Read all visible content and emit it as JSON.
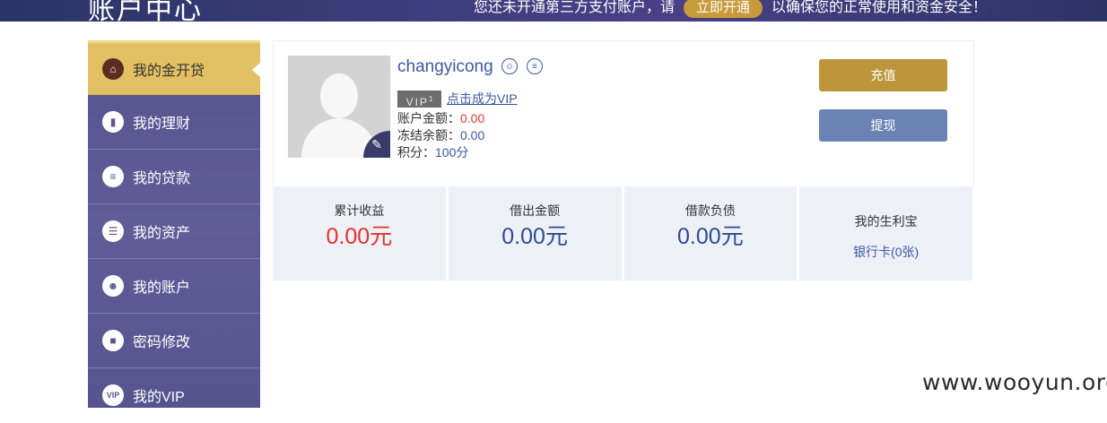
{
  "header": {
    "title": "账户中心",
    "notice_before": "您还未开通第三方支付账户，请",
    "notice_button": "立即开通",
    "notice_after": "以确保您的正常使用和资金安全！"
  },
  "sidebar": {
    "items": [
      {
        "label": "我的金开贷",
        "icon": "home-icon",
        "active": true
      },
      {
        "label": "我的理财",
        "icon": "chart-icon"
      },
      {
        "label": "我的贷款",
        "icon": "notes-icon"
      },
      {
        "label": "我的资产",
        "icon": "coins-icon"
      },
      {
        "label": "我的账户",
        "icon": "id-card-icon"
      },
      {
        "label": "密码修改",
        "icon": "lock-icon"
      },
      {
        "label": "我的VIP",
        "icon": "vip-icon"
      }
    ]
  },
  "profile": {
    "username": "changyicong",
    "vip_badge": "VIP",
    "vip_level": "1",
    "vip_link": "点击成为VIP",
    "balance_label": "账户金额：",
    "balance_value": "0.00",
    "frozen_label": "冻结余额：",
    "frozen_value": "0.00",
    "points_label": "积分：",
    "points_value": "100分"
  },
  "actions": {
    "recharge": "充值",
    "withdraw": "提现"
  },
  "stats": [
    {
      "label": "累计收益",
      "value": "0.00元"
    },
    {
      "label": "借出金额",
      "value": "0.00元"
    },
    {
      "label": "借款负债",
      "value": "0.00元"
    },
    {
      "label": "我的生利宝",
      "link": "银行卡(0张)"
    }
  ],
  "watermark": "www.wooyun.org",
  "colors": {
    "sidebar": "#5d5995",
    "active": "#e2c063",
    "recharge": "#bd963c",
    "withdraw": "#6a82b4",
    "link": "#3a58a6",
    "red": "#e5322b"
  }
}
